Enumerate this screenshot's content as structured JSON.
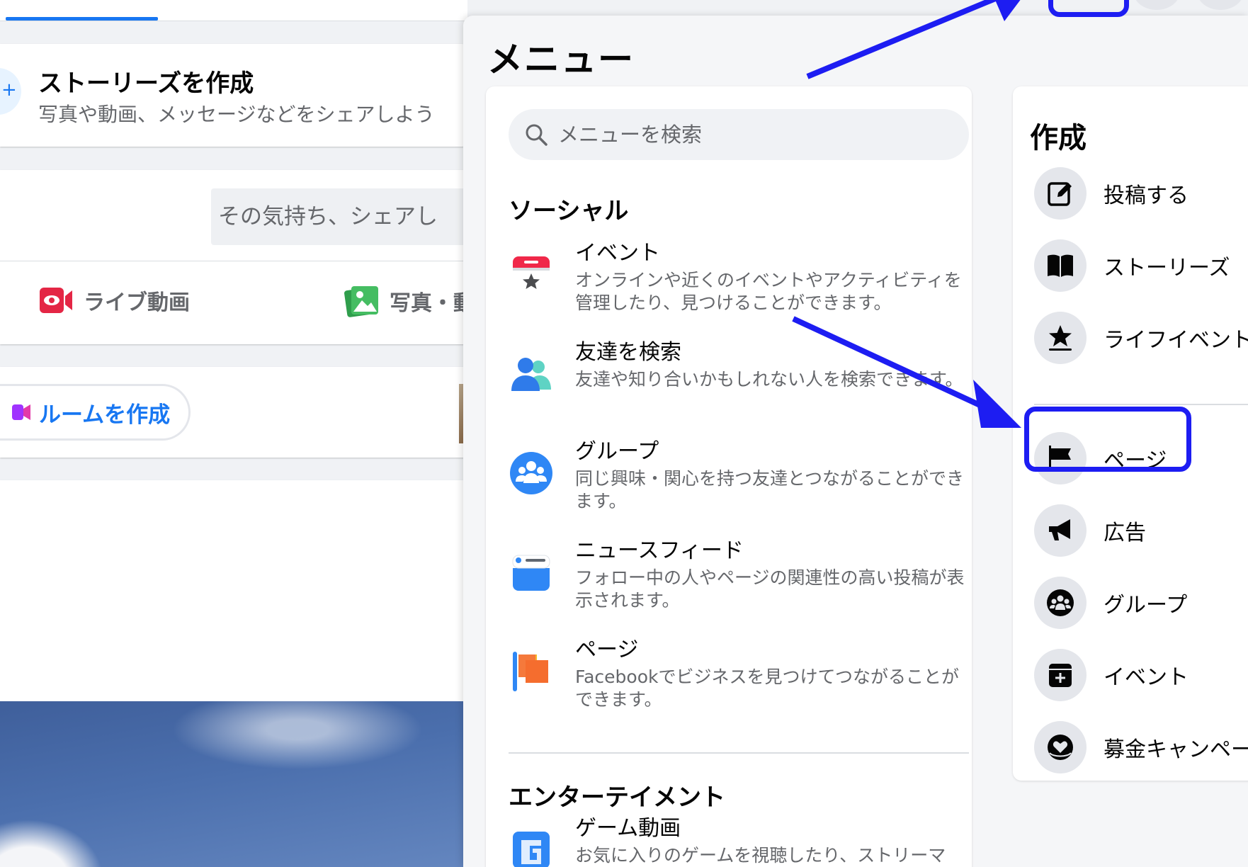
{
  "feed": {
    "story_title": "ストーリーズを作成",
    "story_subtitle": "写真や動画、メッセージなどをシェアしよう",
    "composer_placeholder": "その気持ち、シェアし",
    "actions": [
      {
        "label": "ライブ動画",
        "icon": "live-video-icon",
        "color": "#e42645"
      },
      {
        "label": "写真・動",
        "icon": "photo-icon",
        "color": "#45bd62"
      }
    ],
    "room_button": "ルームを作成"
  },
  "menu": {
    "title": "メニュー",
    "search_placeholder": "メニューを検索",
    "sections": [
      {
        "title": "ソーシャル",
        "items": [
          {
            "name": "イベント",
            "desc": "オンラインや近くのイベントやアクティビティを管理したり、見つけることができます。",
            "icon": "event-calendar-icon"
          },
          {
            "name": "友達を検索",
            "desc": "友達や知り合いかもしれない人を検索できます。",
            "icon": "find-friends-icon"
          },
          {
            "name": "グループ",
            "desc": "同じ興味・関心を持つ友達とつながることができます。",
            "icon": "groups-icon"
          },
          {
            "name": "ニュースフィード",
            "desc": "フォロー中の人やページの関連性の高い投稿が表示されます。",
            "icon": "news-feed-icon"
          },
          {
            "name": "ページ",
            "desc": "Facebookでビジネスを見つけてつながることができます。",
            "icon": "pages-flag-icon"
          }
        ]
      },
      {
        "title": "エンターテイメント",
        "items": [
          {
            "name": "ゲーム動画",
            "desc": "お気に入りのゲームを視聴したり、ストリーマ",
            "icon": "gaming-video-icon"
          }
        ]
      }
    ],
    "create": {
      "title": "作成",
      "items": [
        {
          "label": "投稿する",
          "icon": "edit-post-icon"
        },
        {
          "label": "ストーリーズ",
          "icon": "story-book-icon"
        },
        {
          "label": "ライフイベント",
          "icon": "life-event-star-icon"
        },
        {
          "label": "ページ",
          "icon": "page-flag-icon"
        },
        {
          "label": "広告",
          "icon": "megaphone-icon"
        },
        {
          "label": "グループ",
          "icon": "group-icon"
        },
        {
          "label": "イベント",
          "icon": "event-plus-icon"
        },
        {
          "label": "募金キャンペーン",
          "icon": "fundraiser-heart-icon"
        }
      ]
    }
  },
  "colors": {
    "accent": "#1877f2",
    "annotation": "#1d1df2",
    "secondary_text": "#65676b"
  }
}
